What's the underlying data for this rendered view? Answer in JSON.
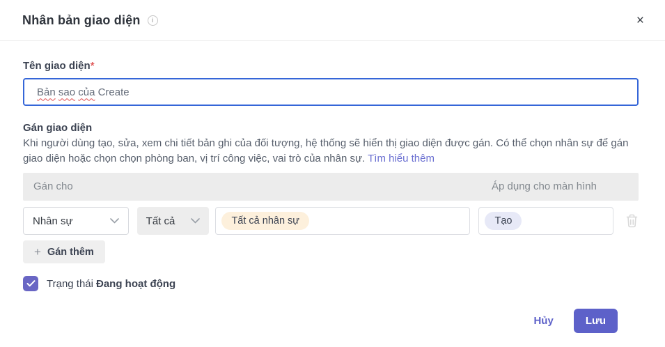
{
  "dialog": {
    "title": "Nhân bản giao diện",
    "info_glyph": "i",
    "close_glyph": "×"
  },
  "name_field": {
    "label": "Tên giao diện",
    "required_mark": "*",
    "value": "Bản sao của Create",
    "words": [
      {
        "text": "Bản",
        "misspelled": true
      },
      {
        "text": "sao",
        "misspelled": true
      },
      {
        "text": "của",
        "misspelled": true
      },
      {
        "text": "Create",
        "misspelled": false
      }
    ]
  },
  "assign_section": {
    "title": "Gán giao diện",
    "description": "Khi người dùng tạo, sửa, xem chi tiết bản ghi của đối tượng, hệ thống sẽ hiển thị giao diện được gán. Có thể chọn nhân sự để gán giao diện hoặc chọn chọn phòng ban, vị trí công việc, vai trò của nhân sự.",
    "learn_more_label": "Tìm hiểu thêm",
    "table": {
      "col1_header": "Gán cho",
      "col2_header": "Áp dụng cho màn hình"
    },
    "row": {
      "target_type_selected": "Nhân sự",
      "scope_selected": "Tất cả",
      "target_tag": "Tất cả nhân sự",
      "screen_tag": "Tạo"
    },
    "add_button": {
      "plus": "+",
      "label": "Gán thêm"
    }
  },
  "status": {
    "label_prefix": "Trạng thái",
    "label_value": "Đang hoạt động",
    "checked": true
  },
  "footer": {
    "cancel_label": "Hủy",
    "save_label": "Lưu"
  },
  "colors": {
    "accent": "#5d61c9",
    "focus_border": "#3566d8",
    "checkbox": "#6966c4",
    "tag_cream": "#fdf0dc",
    "tag_lavender": "#e7e9f7",
    "header_bar": "#ececec"
  }
}
